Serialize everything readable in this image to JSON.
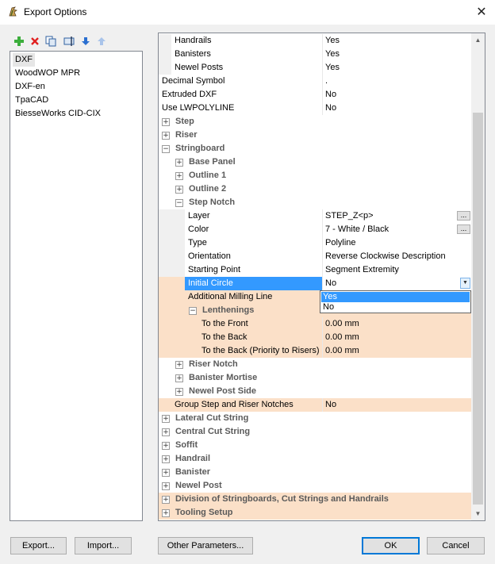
{
  "window": {
    "title": "Export Options",
    "close_glyph": "✕"
  },
  "toolbar": {
    "icons": [
      "add-icon",
      "delete-icon",
      "copy-icon",
      "rename-icon",
      "move-down-icon",
      "move-up-icon"
    ]
  },
  "formats": [
    "DXF",
    "WoodWOP MPR",
    "DXF-en",
    "TpaCAD",
    "BiesseWorks CID-CIX"
  ],
  "selected_format": "DXF",
  "grid": {
    "rows": [
      {
        "label": "Handrails",
        "value": "Yes"
      },
      {
        "label": "Banisters",
        "value": "Yes"
      },
      {
        "label": "Newel Posts",
        "value": "Yes"
      },
      {
        "label": "Decimal Symbol",
        "value": "."
      },
      {
        "label": "Extruded DXF",
        "value": "No"
      },
      {
        "label": "Use LWPOLYLINE",
        "value": "No"
      },
      {
        "label": "Step"
      },
      {
        "label": "Riser"
      },
      {
        "label": "Stringboard"
      },
      {
        "label": "Base Panel"
      },
      {
        "label": "Outline 1"
      },
      {
        "label": "Outline 2"
      },
      {
        "label": "Step Notch"
      },
      {
        "label": "Layer",
        "value": "STEP_Z<p>",
        "button": "..."
      },
      {
        "label": "Color",
        "value": "7 - White / Black",
        "button": "..."
      },
      {
        "label": "Type",
        "value": "Polyline"
      },
      {
        "label": "Orientation",
        "value": "Reverse Clockwise Description"
      },
      {
        "label": "Starting Point",
        "value": "Segment Extremity"
      },
      {
        "label": "Initial Circle",
        "value": "No"
      },
      {
        "label": "Additional Milling Line",
        "value": ""
      },
      {
        "label": "Lenthenings"
      },
      {
        "label": "To the Front",
        "value": "0.00 mm"
      },
      {
        "label": "To the Back",
        "value": "0.00 mm"
      },
      {
        "label": "To the Back (Priority to Risers)",
        "value": "0.00 mm"
      },
      {
        "label": "Riser Notch"
      },
      {
        "label": "Banister Mortise"
      },
      {
        "label": "Newel Post Side"
      },
      {
        "label": "Group Step and Riser Notches",
        "value": "No"
      },
      {
        "label": "Lateral Cut String"
      },
      {
        "label": "Central Cut String"
      },
      {
        "label": "Soffit"
      },
      {
        "label": "Handrail"
      },
      {
        "label": "Banister"
      },
      {
        "label": "Newel Post"
      },
      {
        "label": "Division of Stringboards, Cut Strings and Handrails"
      },
      {
        "label": "Tooling Setup"
      }
    ],
    "dropdown_options": [
      "Yes",
      "No"
    ]
  },
  "buttons": {
    "export": "Export...",
    "import": "Import...",
    "other_parameters": "Other Parameters...",
    "ok": "OK",
    "cancel": "Cancel"
  },
  "colors": {
    "selection": "#3399ff",
    "highlight_row": "#fbe0c8",
    "default_button_border": "#0078d7"
  }
}
